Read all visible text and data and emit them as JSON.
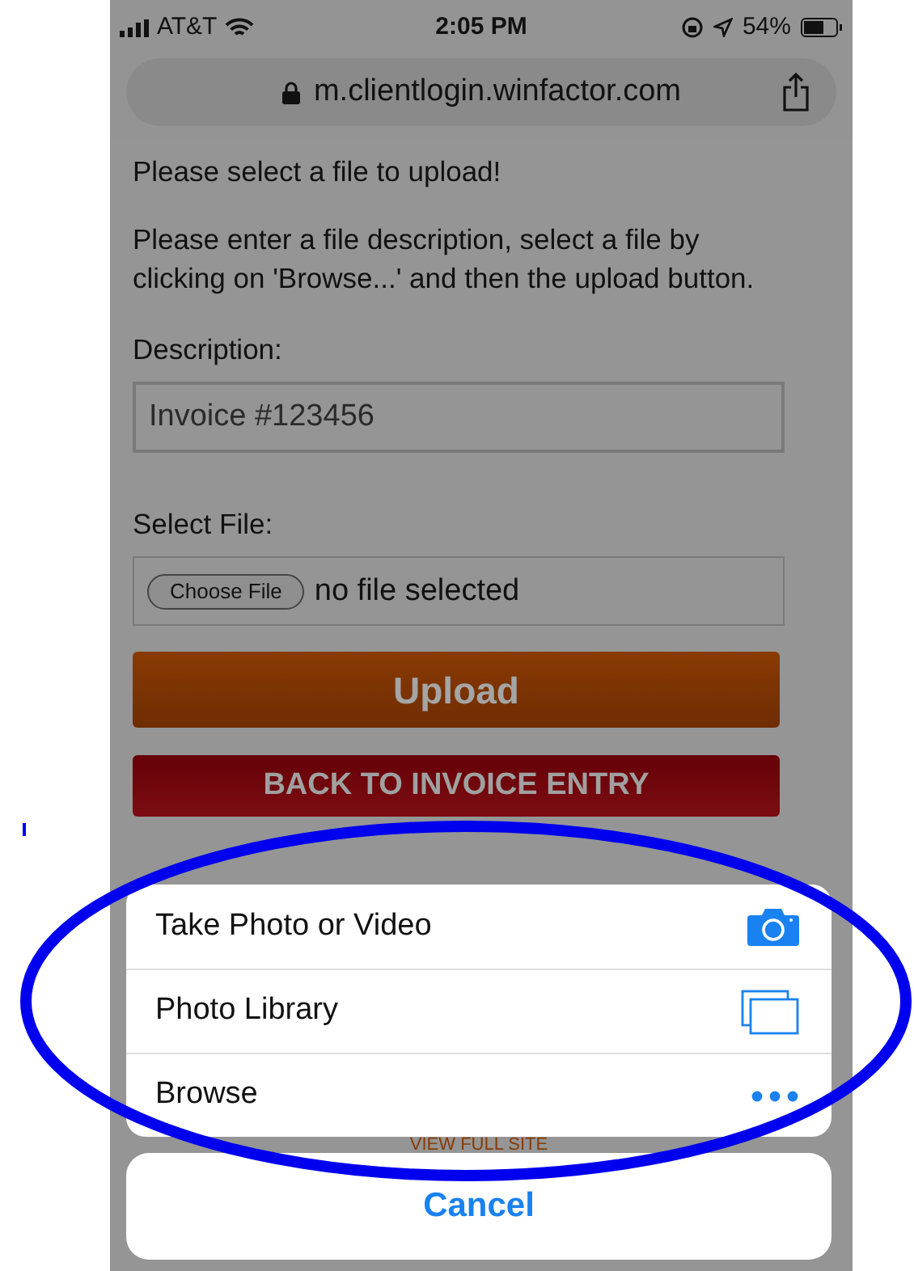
{
  "status_bar": {
    "carrier": "AT&T",
    "time": "2:05 PM",
    "battery": "54%"
  },
  "address_bar": {
    "url": "m.clientlogin.winfactor.com"
  },
  "page": {
    "heading": "Please select a file to upload!",
    "instructions": "Please enter a file description, select a file by clicking on 'Browse...' and then the upload button.",
    "description_label": "Description:",
    "description_value": "Invoice #123456",
    "select_file_label": "Select File:",
    "choose_file_button": "Choose File",
    "file_status": "no file selected",
    "upload_button": "Upload",
    "back_button": "BACK TO INVOICE ENTRY",
    "view_full_site": "VIEW FULL SITE"
  },
  "action_sheet": {
    "options": [
      {
        "label": "Take Photo or Video",
        "kind": "camera"
      },
      {
        "label": "Photo Library",
        "kind": "library"
      },
      {
        "label": "Browse",
        "kind": "more"
      }
    ],
    "cancel": "Cancel"
  }
}
